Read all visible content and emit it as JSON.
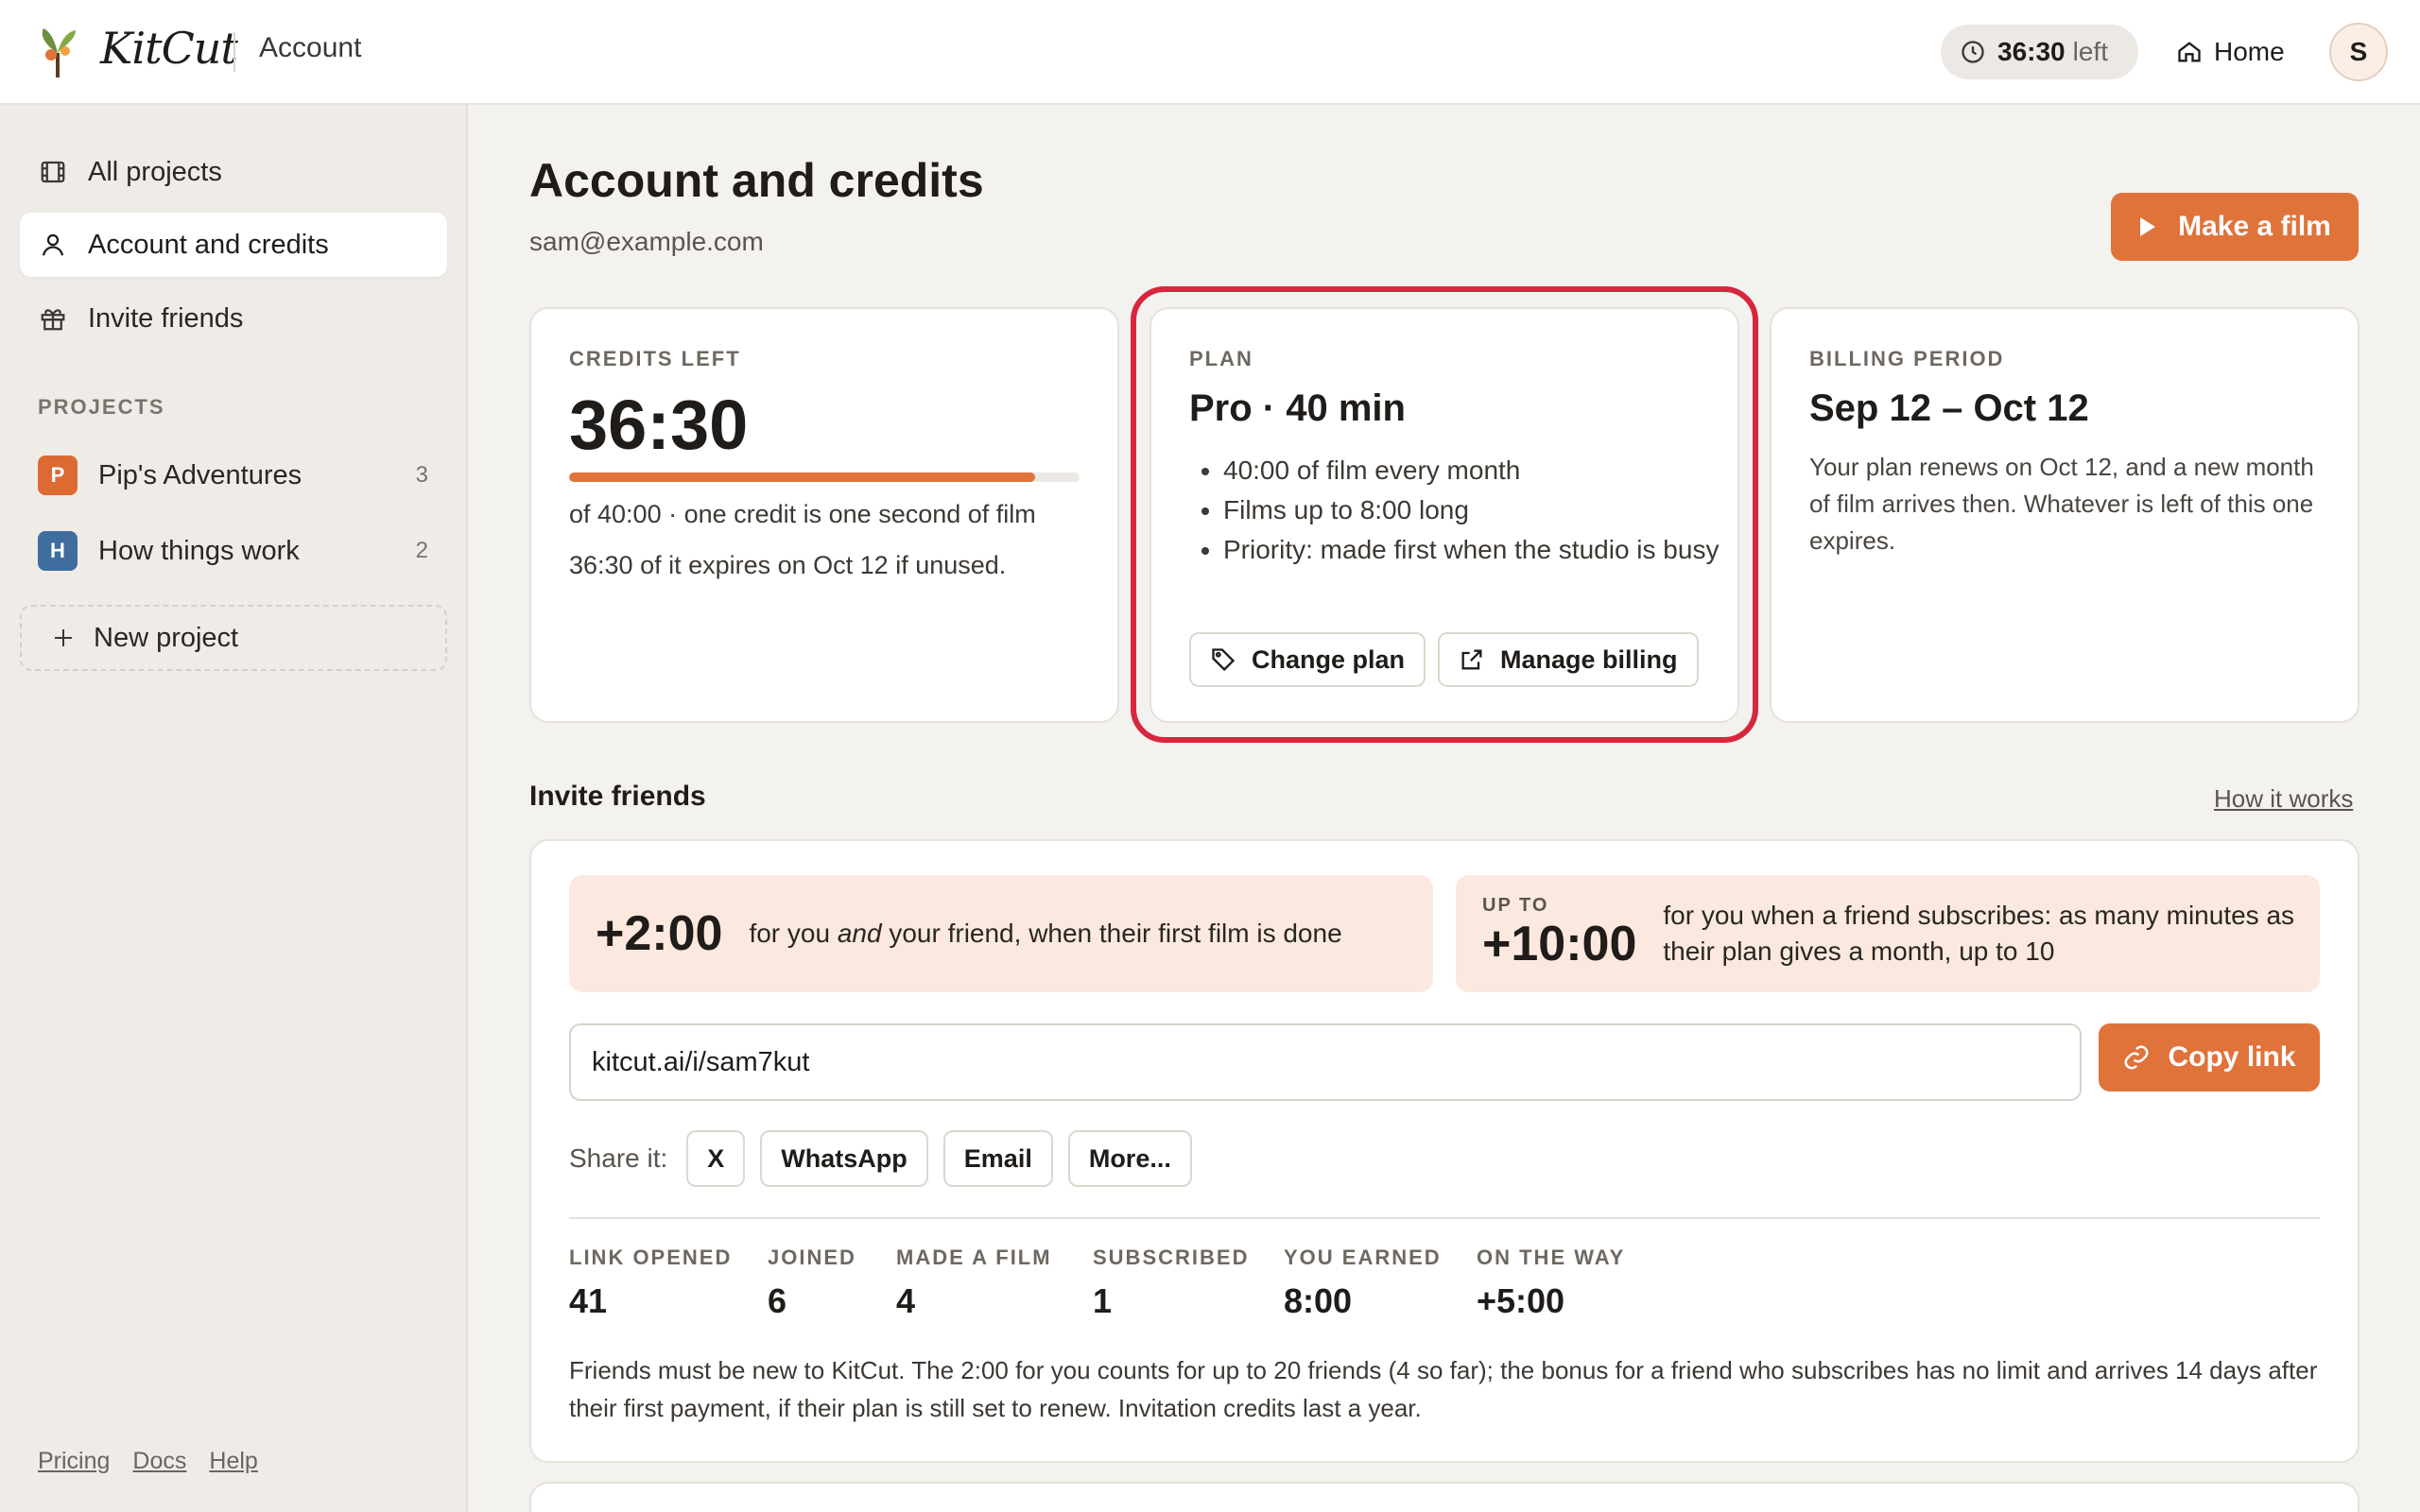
{
  "app": {
    "name": "KitCut",
    "section": "Account"
  },
  "topbar": {
    "credits_value": "36:30",
    "credits_suffix": "left",
    "home_label": "Home",
    "avatar_initial": "S"
  },
  "sidebar": {
    "items": [
      {
        "label": "All projects",
        "icon": "film-icon"
      },
      {
        "label": "Account and credits",
        "icon": "user-icon",
        "active": true
      },
      {
        "label": "Invite friends",
        "icon": "gift-icon"
      }
    ],
    "projects_heading": "PROJECTS",
    "projects": [
      {
        "badge": "P",
        "name": "Pip's Adventures",
        "count": "3",
        "color": "#dd6a33"
      },
      {
        "badge": "H",
        "name": "How things work",
        "count": "2",
        "color": "#3f6e9e"
      }
    ],
    "new_project_label": "New project",
    "footer": [
      "Pricing",
      "Docs",
      "Help"
    ]
  },
  "main": {
    "title": "Account and credits",
    "email": "sam@example.com",
    "make_film_label": "Make a film"
  },
  "credits_card": {
    "eyebrow": "CREDITS LEFT",
    "value": "36:30",
    "progress_fraction": 0.9125,
    "line1": "of 40:00 · one credit is one second of film",
    "line2": "36:30 of it expires on Oct 12 if unused."
  },
  "plan_card": {
    "eyebrow": "PLAN",
    "title": "Pro · 40 min",
    "features": [
      "40:00 of film every month",
      "Films up to 8:00 long",
      "Priority: made first when the studio is busy"
    ],
    "change_plan_label": "Change plan",
    "manage_billing_label": "Manage billing"
  },
  "billing_card": {
    "eyebrow": "BILLING PERIOD",
    "title": "Sep 12 – Oct 12",
    "text": "Your plan renews on Oct 12, and a new month of film arrives then. Whatever is left of this one expires."
  },
  "invite": {
    "heading": "Invite friends",
    "how_it_works": "How it works",
    "promo1": {
      "amount": "+2:00",
      "desc_pre": "for you ",
      "desc_em": "and",
      "desc_post": " your friend, when their first film is done"
    },
    "promo2": {
      "upto": "UP TO",
      "amount": "+10:00",
      "desc": "for you when a friend subscribes: as many minutes as their plan gives a month, up to 10"
    },
    "link_value": "kitcut.ai/i/sam7kut",
    "copy_label": "Copy link",
    "share_label": "Share it:",
    "share_buttons": [
      "X",
      "WhatsApp",
      "Email",
      "More..."
    ],
    "stats": [
      {
        "label": "LINK OPENED",
        "value": "41"
      },
      {
        "label": "JOINED",
        "value": "6"
      },
      {
        "label": "MADE A FILM",
        "value": "4"
      },
      {
        "label": "SUBSCRIBED",
        "value": "1"
      },
      {
        "label": "YOU EARNED",
        "value": "8:00"
      },
      {
        "label": "ON THE WAY",
        "value": "+5:00"
      }
    ],
    "fineprint": "Friends must be new to KitCut. The 2:00 for you counts for up to 20 friends (4 so far); the bonus for a friend who subscribes has no limit and arrives 14 days after their first payment, if their plan is still set to renew. Invitation credits last a year."
  },
  "colors": {
    "accent": "#e0733a",
    "background": "#f4f2ee",
    "highlight": "#d7263d",
    "promo_bg": "#fbe9df"
  }
}
